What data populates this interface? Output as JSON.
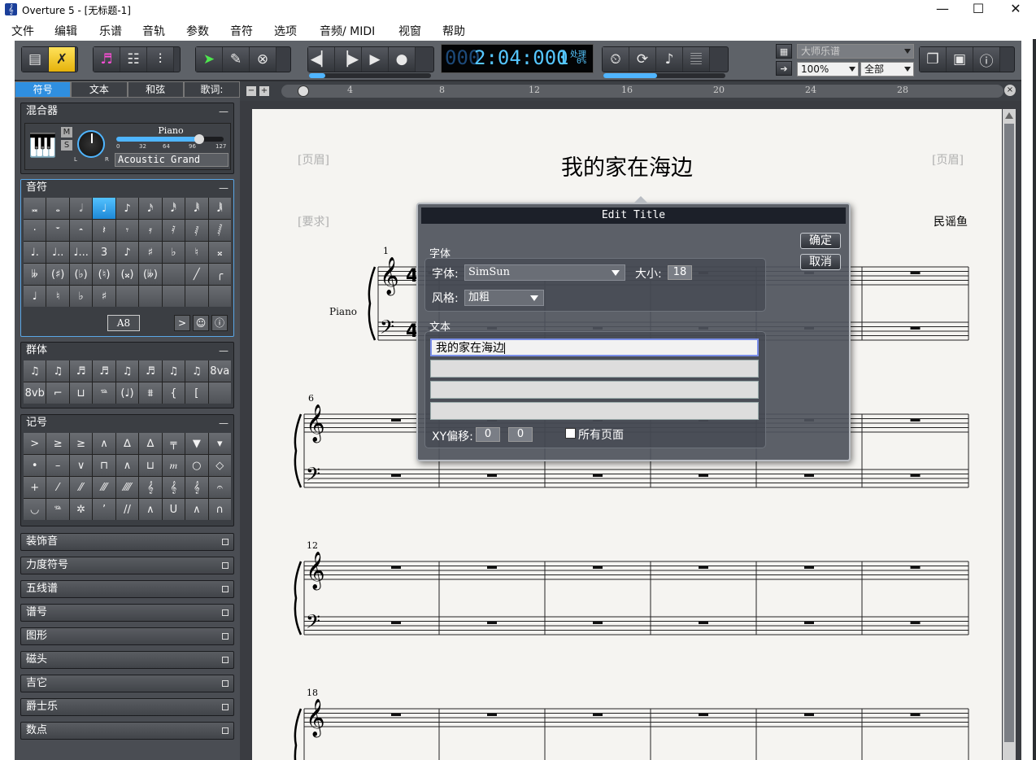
{
  "window": {
    "title": "Overture 5 - [无标题-1]",
    "minimize_glyph": "—",
    "maximize_glyph": "☐",
    "close_glyph": "✕"
  },
  "menu": {
    "items": [
      "文件",
      "编辑",
      "乐谱",
      "音轨",
      "参数",
      "音符",
      "选项",
      "音频/ MIDI",
      "视窗",
      "帮助"
    ]
  },
  "toolbar": {
    "time": {
      "digits": "000",
      "main": "2:04:000",
      "beat": "1",
      "status": "处理",
      "percent": "0%"
    },
    "layout_combo": "大师乐谱",
    "zoom_combo": "100%",
    "view_combo": "全部"
  },
  "left_panel": {
    "tabs": [
      "符号",
      "文本",
      "和弦",
      "歌词:"
    ],
    "mixer": {
      "title": "混合器",
      "instrument": "Piano",
      "patch": "Acoustic Grand",
      "scale": [
        "0",
        "32",
        "64",
        "96",
        "127"
      ],
      "m": "M",
      "s": "S",
      "l": "L",
      "r": "R",
      "value_fraction": 0.77
    },
    "notes": {
      "title": "音符",
      "rows": [
        [
          "𝅜",
          "𝅝",
          "𝅗𝅥",
          "♩",
          "♪",
          "𝅘𝅥𝅯",
          "𝅘𝅥𝅰",
          "𝅘𝅥𝅱",
          "𝅘𝅥𝅲"
        ],
        [
          "·",
          "𝄻",
          "𝄼",
          "𝄽",
          "𝄾",
          "𝄿",
          "𝅀",
          "𝅁",
          "𝅂"
        ],
        [
          "♩.",
          "♩..",
          "♩...",
          "3",
          "♪",
          "♯",
          "♭",
          "♮",
          "𝄪"
        ],
        [
          "𝄫",
          "(♯)",
          "(♭)",
          "(♮)",
          "(𝄪)",
          "(𝄫)",
          "",
          "╱",
          "╭"
        ],
        [
          "♩",
          "♮",
          "♭",
          "♯",
          "",
          "",
          "",
          "",
          ""
        ]
      ],
      "pitch": "A8"
    },
    "groups": {
      "title": "群体",
      "rows": [
        [
          "♫",
          "♫",
          "♬",
          "♬",
          "♫",
          "♬",
          "♫",
          "♫",
          "8va"
        ],
        [
          "8vb",
          "⌐",
          "⊔",
          "𝆮",
          "(♩)",
          "⩩",
          "{",
          "[",
          ""
        ]
      ]
    },
    "symbols": {
      "title": "记号",
      "rows": [
        [
          ">",
          "≥",
          "≥",
          "∧",
          "∆",
          "∆",
          "╤",
          "▼",
          "▾"
        ],
        [
          "•",
          "–",
          "∨",
          "⊓",
          "∧",
          "⊔",
          "𝆐",
          "○",
          "◇"
        ],
        [
          "+",
          "⁄",
          "⁄⁄",
          "⁄⁄⁄",
          "⁄⁄⁄⁄",
          "𝄞",
          "𝄞",
          "𝄞",
          "𝄐"
        ],
        [
          "◡",
          "𝆮",
          "✲",
          "’",
          "//",
          "∧",
          "U",
          "∧",
          "∩"
        ]
      ]
    },
    "collapsed": [
      "装饰音",
      "力度符号",
      "五线谱",
      "谱号",
      "图形",
      "磁头",
      "吉它",
      "爵士乐",
      "数点"
    ]
  },
  "ruler": {
    "labels": [
      "4",
      "8",
      "12",
      "16",
      "20",
      "24",
      "28"
    ]
  },
  "score": {
    "header_left": "[页眉]",
    "header_right": "[页眉]",
    "instructions": "[要求]",
    "title": "我的家在海边",
    "composer": "民谣鱼",
    "instrument": "Piano",
    "measure_numbers": [
      "1",
      "6",
      "12",
      "18"
    ]
  },
  "dialog": {
    "title": "Edit Title",
    "ok": "确定",
    "cancel": "取消",
    "font_section": "字体",
    "font_label": "字体:",
    "font_value": "SimSun",
    "size_label": "大小:",
    "size_value": "18",
    "style_label": "风格:",
    "style_value": "加粗",
    "text_section": "文本",
    "text_lines": [
      "我的家在海边",
      "",
      "",
      ""
    ],
    "xy_label": "XY偏移:",
    "x_value": "0",
    "y_value": "0",
    "all_pages_label": "所有页面"
  }
}
